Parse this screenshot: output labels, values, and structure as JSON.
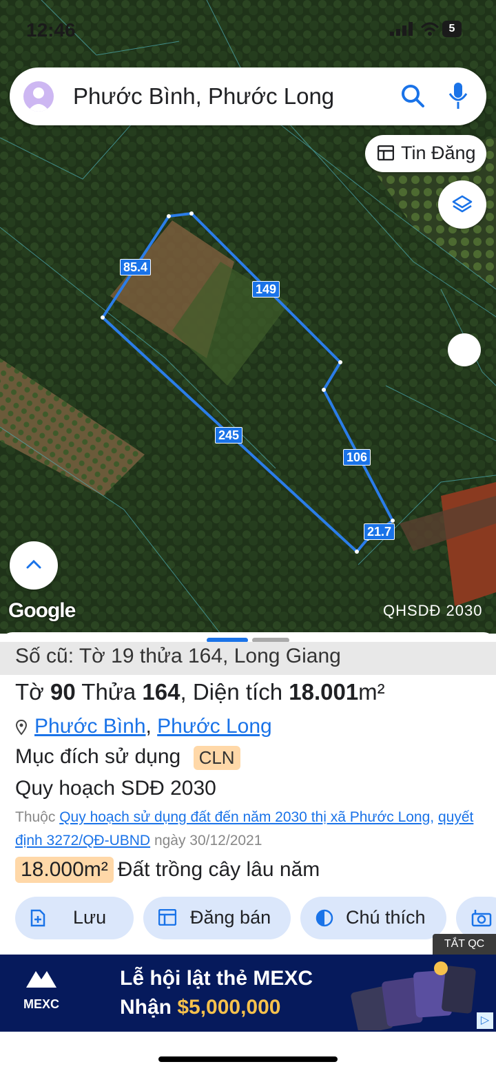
{
  "status_bar": {
    "time": "12:46",
    "battery": "5"
  },
  "search": {
    "query": "Phước Bình, Phước Long"
  },
  "map": {
    "tin_dang_label": "Tin Đăng",
    "google_label": "Google",
    "plan_label": "QHSDĐ 2030",
    "edges": [
      "85.4",
      "149",
      "245",
      "106",
      "21.7"
    ]
  },
  "sheet": {
    "old_info": "Số cũ: Tờ 19 thửa 164, Long Giang",
    "sheet_prefix": "Tờ",
    "sheet_no": "90",
    "parcel_prefix": "Thửa",
    "parcel_no": "164",
    "area_prefix": ", Diện tích",
    "area_value": "18.001",
    "area_unit": "m²",
    "ward": "Phước Bình",
    "town": "Phước Long",
    "purpose_label": "Mục đích sử dụng",
    "purpose_code": "CLN",
    "plan_title": "Quy hoạch SDĐ 2030",
    "belong_prefix": "Thuộc",
    "plan_link": "Quy hoạch sử dụng đất đến năm 2030 thị xã Phước Long",
    "decision_link": "quyết định 3272/QĐ-UBND",
    "date_text": "ngày 30/12/2021",
    "area_pill": "18.000m²",
    "land_type": "Đất trồng cây lâu năm"
  },
  "actions": {
    "save": "Lưu",
    "sell": "Đăng bán",
    "legend": "Chú thích"
  },
  "ad": {
    "close_label": "TẮT QC",
    "brand": "MEXC",
    "line1": "Lễ hội lật thẻ MEXC",
    "line2_prefix": "Nhận",
    "line2_amount": "$5,000,000"
  },
  "colors": {
    "accent": "#1a73e8",
    "pill": "#ffd8a8",
    "ad_bg": "#061a5c"
  }
}
